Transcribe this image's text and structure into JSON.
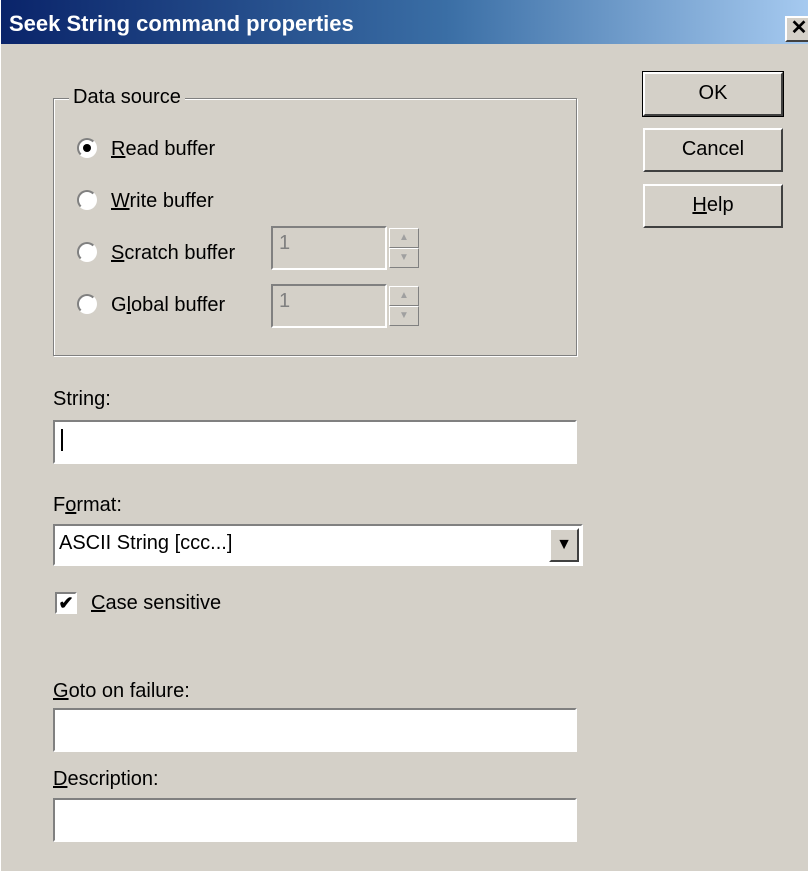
{
  "window": {
    "title": "Seek String command properties",
    "close_glyph": "✕"
  },
  "data_source": {
    "legend": "Data source",
    "options": [
      {
        "label": "Read buffer",
        "mnemonic": "R",
        "rest": "ead buffer",
        "selected": true
      },
      {
        "label": "Write buffer",
        "mnemonic": "W",
        "rest": "rite buffer",
        "selected": false
      },
      {
        "label": "Scratch buffer",
        "mnemonic": "S",
        "rest": "cratch buffer",
        "selected": false,
        "spin_value": "1"
      },
      {
        "label": "Global buffer",
        "pre": "G",
        "mnemonic": "l",
        "rest": "obal buffer",
        "selected": false,
        "spin_value": "1"
      }
    ],
    "spin_up_glyph": "▲",
    "spin_down_glyph": "▼"
  },
  "string": {
    "label": "String:",
    "value": ""
  },
  "format": {
    "label_pre": "F",
    "label_mnemonic": "o",
    "label_rest": "rmat:",
    "selected": "ASCII String  [ccc...]",
    "drop_glyph": "▼"
  },
  "case_sensitive": {
    "label_mnemonic": "C",
    "label_rest": "ase sensitive",
    "checked": true,
    "check_glyph": "✔"
  },
  "goto_on_failure": {
    "label_mnemonic": "G",
    "label_rest": "oto on failure:",
    "value": ""
  },
  "description": {
    "label_mnemonic": "D",
    "label_rest": "escription:",
    "value": ""
  },
  "buttons": {
    "ok": "OK",
    "cancel": "Cancel",
    "help_mnemonic": "H",
    "help_rest": "elp"
  }
}
